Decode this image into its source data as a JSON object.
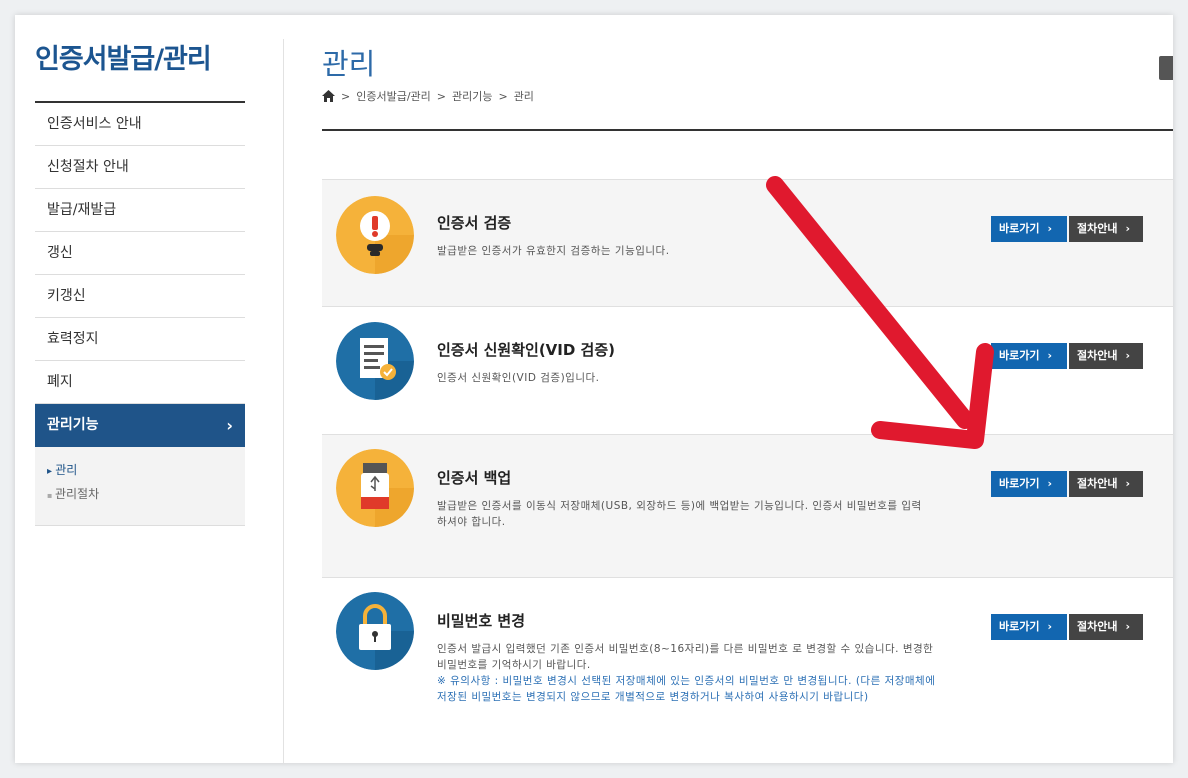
{
  "sidebar": {
    "title": "인증서발급/관리",
    "items": [
      {
        "label": "인증서비스 안내"
      },
      {
        "label": "신청절차 안내"
      },
      {
        "label": "발급/재발급"
      },
      {
        "label": "갱신"
      },
      {
        "label": "키갱신"
      },
      {
        "label": "효력정지"
      },
      {
        "label": "폐지"
      },
      {
        "label": "관리기능"
      }
    ],
    "active_chevron": "›",
    "submenu": [
      {
        "label": "관리"
      },
      {
        "label": "관리절차"
      }
    ]
  },
  "header": {
    "title": "관리",
    "breadcrumb": [
      "인증서발급/관리",
      "관리기능",
      "관리"
    ],
    "breadcrumb_sep": ">"
  },
  "buttons": {
    "go_label": "바로가기",
    "proc_label": "절차안내",
    "arrow": "›"
  },
  "cards": [
    {
      "title": "인증서 검증",
      "desc": "발급받은 인증서가 유효한지 검증하는 기능입니다.",
      "icon": "alert-icon",
      "icon_color": "#f5b23a"
    },
    {
      "title": "인증서 신원확인(VID 검증)",
      "desc": "인증서 신원확인(VID 검증)입니다.",
      "icon": "document-check-icon",
      "icon_color": "#1f6fa6"
    },
    {
      "title": "인증서 백업",
      "desc": "발급받은 인증서를 이동식 저장매체(USB, 외장하드 등)에 백업받는 기능입니다. 인증서 비밀번호를 입력하셔야 합니다.",
      "icon": "usb-icon",
      "icon_color": "#f5b23a"
    },
    {
      "title": "비밀번호 변경",
      "desc": "인증서 발급시 입력했던 기존 인증서 비밀번호(8~16자리)를 다른 비밀번호 로 변경할 수 있습니다. 변경한 비밀번호를 기억하시기 바랍니다.",
      "note": "※ 유의사항 : 비밀번호 변경시 선택된 저장매체에 있는 인증서의 비밀번호 만 변경됩니다. (다른 저장매체에 저장된 비밀번호는 변경되지 않으므로 개별적으로 변경하거나 복사하여 사용하시기 바랍니다)",
      "icon": "lock-icon",
      "icon_color": "#1f6fa6"
    }
  ],
  "colors": {
    "brand": "#1f5489",
    "go_button": "#1266b0",
    "annotation_arrow": "#e0192e"
  }
}
